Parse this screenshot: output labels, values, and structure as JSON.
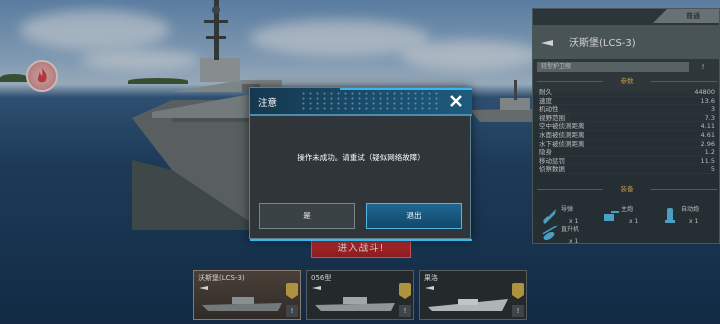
{
  "ship_stats": {
    "tag": "普通",
    "name": "沃斯堡(LCS-3)",
    "ship_class": "轻型护卫舰",
    "class_badge": "!",
    "params_header": "参数",
    "rows": [
      {
        "label": "耐久",
        "value": "44800"
      },
      {
        "label": "速度",
        "value": "13.6"
      },
      {
        "label": "机动性",
        "value": "3"
      },
      {
        "label": "视野范围",
        "value": "7.3"
      },
      {
        "label": "空中被侦测距离",
        "value": "4.11"
      },
      {
        "label": "水面被侦测距离",
        "value": "4.61"
      },
      {
        "label": "水下被侦测距离",
        "value": "2.96"
      },
      {
        "label": "隐身",
        "value": "1.2"
      },
      {
        "label": "移动惩罚",
        "value": "11.5"
      },
      {
        "label": "侦察数据",
        "value": "5"
      }
    ],
    "equipment_header": "装备",
    "weapons": [
      {
        "name": "导弹",
        "count": "x 1",
        "icon": "missile-icon"
      },
      {
        "name": "主炮",
        "count": "x 1",
        "icon": "main-gun-icon"
      },
      {
        "name": "自动炮",
        "count": "x 1",
        "icon": "autocannon-icon"
      },
      {
        "name": "直升机",
        "count": "x 1",
        "icon": "helicopter-icon"
      }
    ]
  },
  "battle_button": "进入战斗!",
  "ship_cards": [
    {
      "name": "沃斯堡(LCS-3)",
      "selected": true,
      "badge": "!"
    },
    {
      "name": "056型",
      "selected": false,
      "badge": "!"
    },
    {
      "name": "果洛",
      "selected": false,
      "badge": "!"
    }
  ],
  "dialog": {
    "title": "注意",
    "message": "操作未成功。请重试（疑似网络故障）",
    "yes_label": "是",
    "quit_label": "退出"
  },
  "colors": {
    "accent_blue": "#39b7ec",
    "battle_red": "#c32d30",
    "gold": "#e9b55b"
  }
}
